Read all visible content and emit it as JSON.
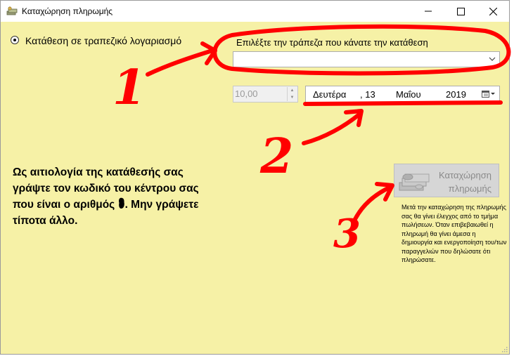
{
  "window": {
    "title": "Καταχώρηση πληρωμής"
  },
  "payment_method": {
    "label": "Κατάθεση σε τραπεζικό λογαριασμό",
    "selected": true
  },
  "bank": {
    "label": "Επιλέξτε την τράπεζα που κάνατε την κατάθεση",
    "value": ""
  },
  "amount": {
    "value": "10,00"
  },
  "date": {
    "weekday": "Δευτέρα",
    "day": ", 13",
    "month": "Μαΐου",
    "year": "2019"
  },
  "instructions": {
    "before": "Ως αιτιολογία της κατάθεσής σας γράψτε τον κωδικό του κέντρου σας που είναι ο αριθμός ",
    "after": ". Μην γράψετε τίποτα άλλο."
  },
  "submit": {
    "line1": "Καταχώρηση",
    "line2": "πληρωμής"
  },
  "note": "Μετά την καταχώρηση της πληρωμής σας θα γίνει έλεγχος από το τμήμα πωλήσεων. Όταν επιβεβαιωθεί η πληρωμή θα γίνει άμεσα η δημιουργία και ενεργοποίηση του/των παραγγελιών που δηλώσατε ότι πληρώσατε.",
  "icons": [
    "app-money-icon",
    "minimize-icon",
    "maximize-icon",
    "close-icon",
    "chevron-down-icon",
    "calendar-icon",
    "money-stack-icon",
    "resize-grip-icon"
  ],
  "colors": {
    "window_background": "#f6f1a6",
    "annotation": "#ff0000"
  },
  "annotations": [
    "1",
    "2",
    "3"
  ]
}
